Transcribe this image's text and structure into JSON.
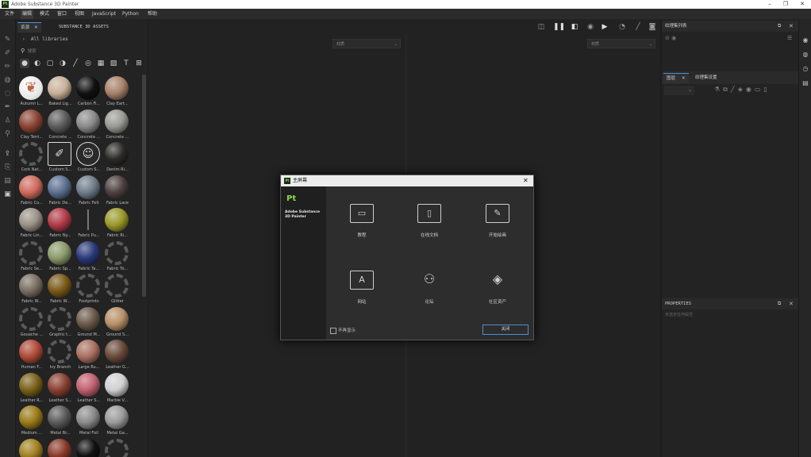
{
  "app": {
    "title": "Adobe Substance 3D Painter",
    "icon_text": "Pt"
  },
  "window_controls": {
    "minimize": "–",
    "restore": "❐",
    "close": "✕"
  },
  "menu": [
    "文件",
    "编辑",
    "模式",
    "窗口",
    "视图",
    "JavaScript",
    "Python",
    "帮助"
  ],
  "assets": {
    "tabs": [
      "资源",
      "SUBSTANCE 3D ASSETS"
    ],
    "library": "All libraries",
    "search_placeholder": "搜索",
    "materials": [
      {
        "label": "Autumn L...",
        "color": "#b86a48",
        "style": "leaf"
      },
      {
        "label": "Baked Lig...",
        "color": "#c9b19a",
        "style": "ball"
      },
      {
        "label": "Carbon Fi...",
        "color": "#111111",
        "style": "ball"
      },
      {
        "label": "Clay Eart...",
        "color": "#a8826a",
        "style": "ball"
      },
      {
        "label": "Clay Terri...",
        "color": "#8a4534",
        "style": "ball"
      },
      {
        "label": "Concrete ...",
        "color": "#5c5c5c",
        "style": "ball"
      },
      {
        "label": "Concrete ...",
        "color": "#8a8a8a",
        "style": "ball"
      },
      {
        "label": "Concrete ...",
        "color": "#9a9a94",
        "style": "ball"
      },
      {
        "label": "Cork Nat...",
        "color": "#555555",
        "style": "ring"
      },
      {
        "label": "Custom S...",
        "color": "#dddddd",
        "style": "custom"
      },
      {
        "label": "Custom S...",
        "color": "#dddddd",
        "style": "smiley"
      },
      {
        "label": "Denim Ri...",
        "color": "#2c2a28",
        "style": "ball"
      },
      {
        "label": "Fabric Co...",
        "color": "#d06b5e",
        "style": "ball"
      },
      {
        "label": "Fabric De...",
        "color": "#5c7090",
        "style": "ball"
      },
      {
        "label": "Fabric Felt",
        "color": "#707c8a",
        "style": "ball"
      },
      {
        "label": "Fabric Lace",
        "color": "#4e4040",
        "style": "ball"
      },
      {
        "label": "Fabric Lin...",
        "color": "#9a9288",
        "style": "ball"
      },
      {
        "label": "Fabric Ny...",
        "color": "#b23a48",
        "style": "ball"
      },
      {
        "label": "Fabric Pu...",
        "color": "#444444",
        "style": "stick"
      },
      {
        "label": "Fabric Ri...",
        "color": "#9a9a2a",
        "style": "ball"
      },
      {
        "label": "Fabric Se...",
        "color": "#555555",
        "style": "ring"
      },
      {
        "label": "Fabric Sp...",
        "color": "#8a9a6a",
        "style": "ball"
      },
      {
        "label": "Fabric Ta...",
        "color": "#2a3a7a",
        "style": "ball"
      },
      {
        "label": "Fabric To...",
        "color": "#555555",
        "style": "ring"
      },
      {
        "label": "Fabric W...",
        "color": "#7a6e62",
        "style": "ball"
      },
      {
        "label": "Fabric W...",
        "color": "#7a5a18",
        "style": "ball"
      },
      {
        "label": "Footprints",
        "color": "#555555",
        "style": "ring"
      },
      {
        "label": "Glitter",
        "color": "#555555",
        "style": "ring"
      },
      {
        "label": "Gouache ...",
        "color": "#555555",
        "style": "ring"
      },
      {
        "label": "Graphic t...",
        "color": "#555555",
        "style": "ring"
      },
      {
        "label": "Ground M...",
        "color": "#6a5a4a",
        "style": "ball"
      },
      {
        "label": "Ground S...",
        "color": "#b89068",
        "style": "ball"
      },
      {
        "label": "Human F...",
        "color": "#b04a38",
        "style": "ball"
      },
      {
        "label": "Ivy Branch",
        "color": "#555555",
        "style": "ring"
      },
      {
        "label": "Large Ru...",
        "color": "#aa7060",
        "style": "ball"
      },
      {
        "label": "Leather G...",
        "color": "#6a4a3a",
        "style": "ball"
      },
      {
        "label": "Leather R...",
        "color": "#7a6018",
        "style": "ball"
      },
      {
        "label": "Leather S...",
        "color": "#8a4032",
        "style": "ball"
      },
      {
        "label": "Leather S...",
        "color": "#c06070",
        "style": "ball"
      },
      {
        "label": "Marble V...",
        "color": "#d0d0d0",
        "style": "ball"
      },
      {
        "label": "Medium ...",
        "color": "#9a7a18",
        "style": "ball"
      },
      {
        "label": "Metal Br...",
        "color": "#5a5a5a",
        "style": "ball"
      },
      {
        "label": "Metal Foil",
        "color": "#8a8a8a",
        "style": "ball"
      },
      {
        "label": "Metal Ga...",
        "color": "#9a9a9a",
        "style": "ball"
      },
      {
        "label": "",
        "color": "#a08020",
        "style": "ball"
      },
      {
        "label": "",
        "color": "#8a3a2a",
        "style": "ball"
      },
      {
        "label": "",
        "color": "#111111",
        "style": "ball"
      },
      {
        "label": "",
        "color": "#555555",
        "style": "ring"
      }
    ]
  },
  "viewport": {
    "left_dropdown": "材质",
    "right_dropdown": "材质"
  },
  "right_panel": {
    "texture_set_list": "纹理集列表",
    "layers_tab": "图层",
    "texture_set_settings_tab": "纹理集设置",
    "properties_title": "PROPERTIES",
    "properties_empty": "未选定任何属性"
  },
  "dialog": {
    "title": "主屏幕",
    "product_icon": "Pt",
    "product_name": "Adobe Substance 3D Painter",
    "tiles": [
      {
        "label": "教程",
        "icon": "tutorial-icon",
        "glyph": "▭"
      },
      {
        "label": "在线文档",
        "icon": "docs-icon",
        "glyph": "▯"
      },
      {
        "label": "开始绘画",
        "icon": "paint-icon",
        "glyph": "✎"
      },
      {
        "label": "网站",
        "icon": "website-icon",
        "glyph": "A"
      },
      {
        "label": "论坛",
        "icon": "forum-icon",
        "glyph": "⚇"
      },
      {
        "label": "社区资产",
        "icon": "community-icon",
        "glyph": "◈"
      }
    ],
    "checkbox_label": "不再显示",
    "close_button": "关闭"
  }
}
